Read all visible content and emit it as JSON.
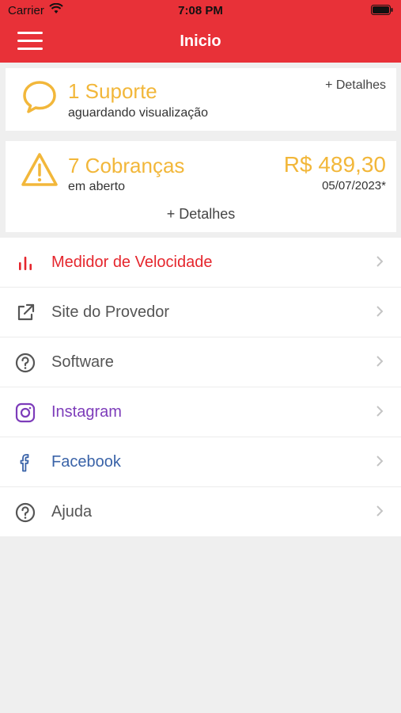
{
  "status_bar": {
    "carrier": "Carrier",
    "time": "7:08 PM"
  },
  "header": {
    "title": "Inicio",
    "menu_icon": "hamburger-icon"
  },
  "support_card": {
    "title": "1 Suporte",
    "subtitle": "aguardando visualização",
    "details_label": "+ Detalhes",
    "icon": "chat-bubble-icon"
  },
  "billing_card": {
    "title": "7 Cobranças",
    "subtitle": "em aberto",
    "amount": "R$ 489,30",
    "due_date": "05/07/2023*",
    "details_label": "+ Detalhes",
    "icon": "warning-icon"
  },
  "menu": {
    "items": [
      {
        "label": "Medidor de Velocidade",
        "icon": "bar-chart-icon",
        "color": "#e5262d"
      },
      {
        "label": "Site do Provedor",
        "icon": "external-link-icon",
        "color": "#555555"
      },
      {
        "label": "Software",
        "icon": "help-circle-icon",
        "color": "#555555"
      },
      {
        "label": "Instagram",
        "icon": "instagram-icon",
        "color": "#7d3cba"
      },
      {
        "label": "Facebook",
        "icon": "facebook-icon",
        "color": "#3a63a8"
      },
      {
        "label": "Ajuda",
        "icon": "help-circle-icon",
        "color": "#555555"
      }
    ]
  },
  "colors": {
    "brand": "#e83138",
    "accent": "#f2b73a",
    "background": "#efefef"
  }
}
